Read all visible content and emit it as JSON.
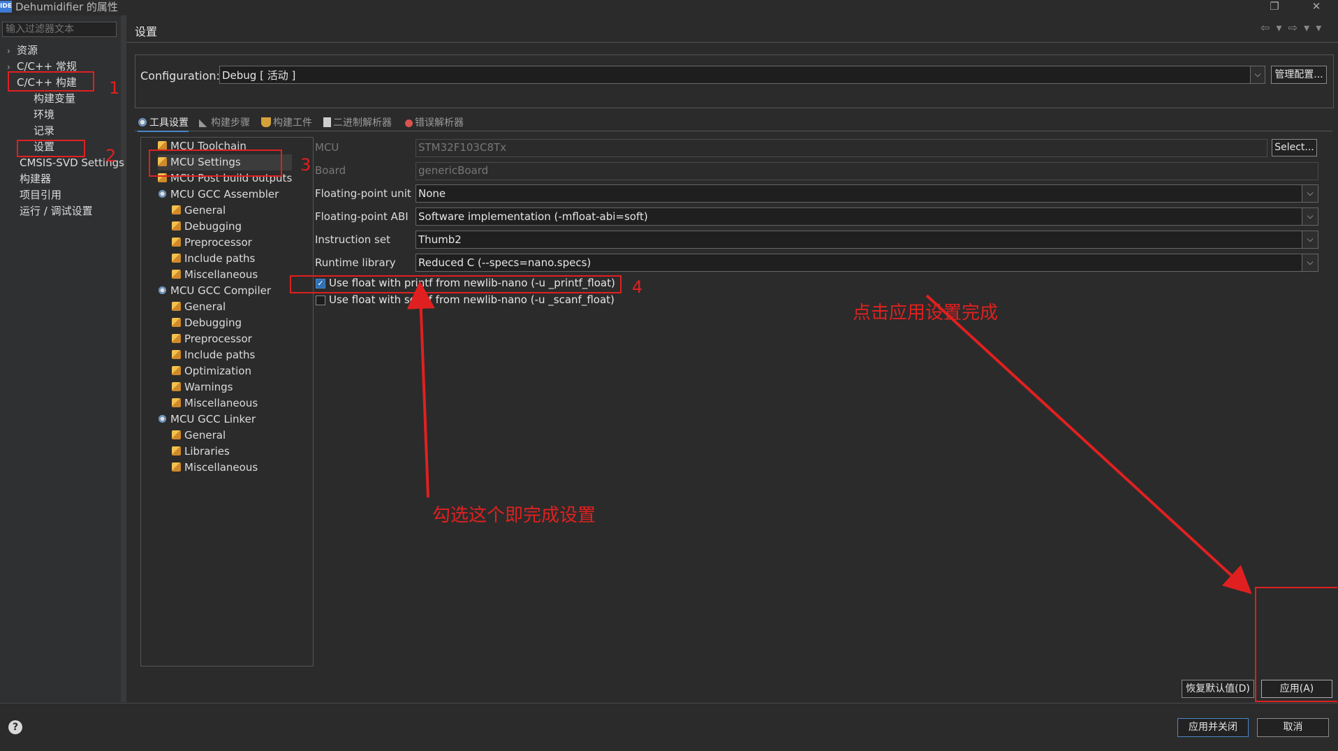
{
  "window": {
    "title": "Dehumidifier 的属性",
    "app_icon_text": "IDE",
    "restore_glyph": "❐",
    "close_glyph": "✕"
  },
  "filter": {
    "placeholder": "输入过滤器文本"
  },
  "sidebar": {
    "items": [
      {
        "label": "资源",
        "arrow": "›"
      },
      {
        "label": "C/C++ 常规",
        "arrow": "›"
      },
      {
        "label": "C/C++ 构建",
        "arrow": ""
      },
      {
        "label": "构建变量"
      },
      {
        "label": "环境"
      },
      {
        "label": "记录"
      },
      {
        "label": "设置"
      },
      {
        "label": "CMSIS-SVD Settings"
      },
      {
        "label": "构建器"
      },
      {
        "label": "项目引用"
      },
      {
        "label": "运行 / 调试设置"
      }
    ]
  },
  "header": {
    "title": "设置",
    "nav_arrows": "⇦ ▾ ⇨ ▾ ▾"
  },
  "configuration": {
    "label": "Configuration:",
    "value": "Debug  [ 活动 ]",
    "manage_button": "管理配置..."
  },
  "tabs": [
    {
      "label": "工具设置",
      "icon": "gear-icon"
    },
    {
      "label": "构建步骤",
      "icon": "wrench-icon"
    },
    {
      "label": "构建工件",
      "icon": "trophy-icon"
    },
    {
      "label": "二进制解析器",
      "icon": "document-icon"
    },
    {
      "label": "错误解析器",
      "icon": "error-icon"
    }
  ],
  "tree": {
    "nodes": [
      {
        "label": "MCU Toolchain",
        "icon": "tool-icon"
      },
      {
        "label": "MCU Settings",
        "icon": "tool-icon"
      },
      {
        "label": "MCU Post build outputs",
        "icon": "tool-icon"
      },
      {
        "label": "MCU GCC Assembler",
        "icon": "gear-icon"
      },
      {
        "label": "General",
        "icon": "tool-icon"
      },
      {
        "label": "Debugging",
        "icon": "tool-icon"
      },
      {
        "label": "Preprocessor",
        "icon": "tool-icon"
      },
      {
        "label": "Include paths",
        "icon": "tool-icon"
      },
      {
        "label": "Miscellaneous",
        "icon": "tool-icon"
      },
      {
        "label": "MCU GCC Compiler",
        "icon": "gear-icon"
      },
      {
        "label": "General",
        "icon": "tool-icon"
      },
      {
        "label": "Debugging",
        "icon": "tool-icon"
      },
      {
        "label": "Preprocessor",
        "icon": "tool-icon"
      },
      {
        "label": "Include paths",
        "icon": "tool-icon"
      },
      {
        "label": "Optimization",
        "icon": "tool-icon"
      },
      {
        "label": "Warnings",
        "icon": "tool-icon"
      },
      {
        "label": "Miscellaneous",
        "icon": "tool-icon"
      },
      {
        "label": "MCU GCC Linker",
        "icon": "gear-icon"
      },
      {
        "label": "General",
        "icon": "tool-icon"
      },
      {
        "label": "Libraries",
        "icon": "tool-icon"
      },
      {
        "label": "Miscellaneous",
        "icon": "tool-icon"
      }
    ]
  },
  "form": {
    "mcu": {
      "label": "MCU",
      "value": "STM32F103C8Tx",
      "button": "Select..."
    },
    "board": {
      "label": "Board",
      "value": "genericBoard"
    },
    "fpu": {
      "label": "Floating-point unit",
      "value": "None"
    },
    "fabi": {
      "label": "Floating-point ABI",
      "value": "Software implementation (-mfloat-abi=soft)"
    },
    "iset": {
      "label": "Instruction set",
      "value": "Thumb2"
    },
    "rtlib": {
      "label": "Runtime library",
      "value": "Reduced C (--specs=nano.specs)"
    },
    "printf_float": {
      "label": "Use float with printf from newlib-nano (-u _printf_float)",
      "checked": true
    },
    "scanf_float": {
      "label": "Use float with scanf from newlib-nano (-u _scanf_float)",
      "checked": false
    },
    "dropdown_glyph": "⌵",
    "check_glyph": "✓"
  },
  "annotations": {
    "n1": "1",
    "n2": "2",
    "n3": "3",
    "n4": "4",
    "check_note": "勾选这个即完成设置",
    "apply_note": "点击应用设置完成",
    "color": "#e02020"
  },
  "buttons": {
    "restore": "恢复默认值(D)",
    "apply": "应用(A)",
    "apply_close": "应用并关闭",
    "cancel": "取消",
    "help": "?"
  }
}
